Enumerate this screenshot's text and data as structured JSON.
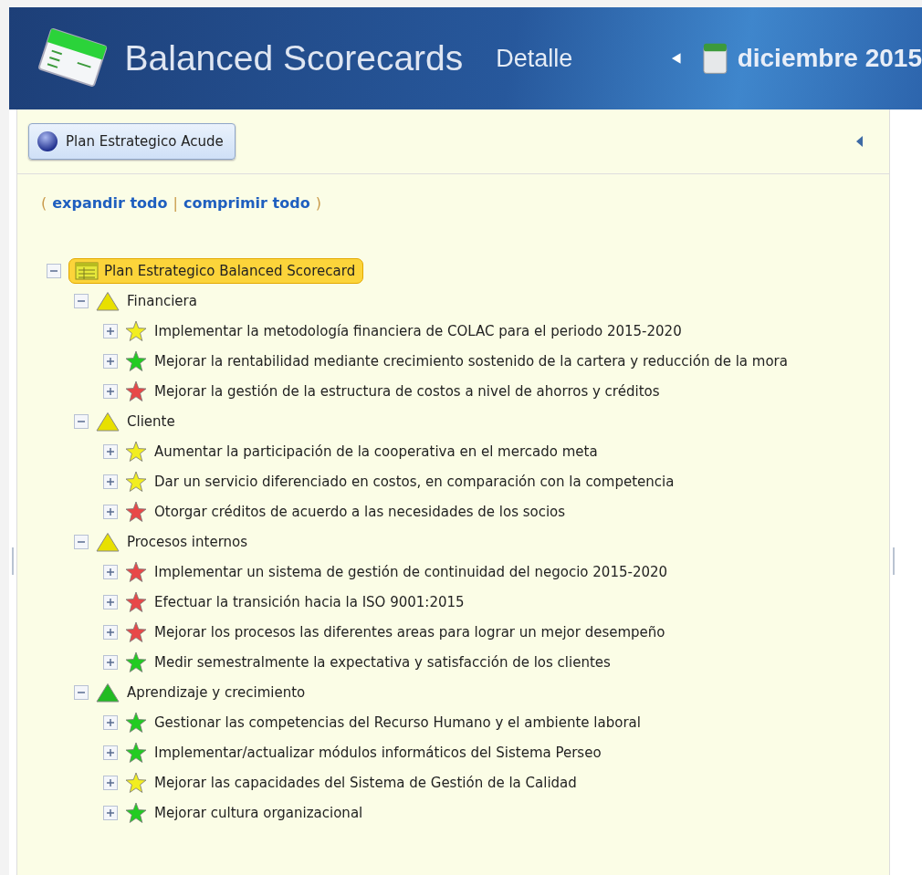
{
  "header": {
    "title": "Balanced Scorecards",
    "subtitle": "Detalle",
    "period": "diciembre 2015"
  },
  "plan_button": {
    "label": "Plan Estrategico Acude"
  },
  "links": {
    "open": "(",
    "expand": "expandir todo",
    "separator": "|",
    "collapse": "comprimir todo",
    "close": ")"
  },
  "tree": {
    "label": "Plan Estrategico Balanced Scorecard",
    "expanded": true,
    "selected": true,
    "children": [
      {
        "label": "Financiera",
        "expanded": true,
        "color": "#e8e000",
        "children": [
          {
            "label": "Implementar la metodología financiera de COLAC para el periodo 2015-2020",
            "expanded": false,
            "color": "#f2ee20"
          },
          {
            "label": "Mejorar la rentabilidad mediante crecimiento sostenido de la cartera y reducción de la mora",
            "expanded": false,
            "color": "#22cc22"
          },
          {
            "label": "Mejorar la gestión de la estructura de costos a nivel de ahorros y créditos",
            "expanded": false,
            "color": "#e84848"
          }
        ]
      },
      {
        "label": "Cliente",
        "expanded": true,
        "color": "#e8e000",
        "children": [
          {
            "label": "Aumentar la participación de la cooperativa en el mercado meta",
            "expanded": false,
            "color": "#f2ee20"
          },
          {
            "label": "Dar un servicio diferenciado en costos, en comparación con la competencia",
            "expanded": false,
            "color": "#f2ee20"
          },
          {
            "label": "Otorgar créditos de acuerdo a las necesidades de los socios",
            "expanded": false,
            "color": "#e84848"
          }
        ]
      },
      {
        "label": "Procesos internos",
        "expanded": true,
        "color": "#e8e000",
        "children": [
          {
            "label": "Implementar un sistema de gestión de continuidad del negocio 2015-2020",
            "expanded": false,
            "color": "#e84848"
          },
          {
            "label": "Efectuar la transición hacia la ISO 9001:2015",
            "expanded": false,
            "color": "#e84848"
          },
          {
            "label": "Mejorar los procesos las diferentes areas para lograr un mejor desempeño",
            "expanded": false,
            "color": "#e84848"
          },
          {
            "label": "Medir semestralmente la expectativa y satisfacción de los clientes",
            "expanded": false,
            "color": "#22cc22"
          }
        ]
      },
      {
        "label": "Aprendizaje y crecimiento",
        "expanded": true,
        "color": "#22bb22",
        "children": [
          {
            "label": "Gestionar las competencias del Recurso Humano y el ambiente laboral",
            "expanded": false,
            "color": "#22cc22"
          },
          {
            "label": "Implementar/actualizar módulos informáticos del Sistema Perseo",
            "expanded": false,
            "color": "#22cc22"
          },
          {
            "label": "Mejorar las capacidades del Sistema de Gestión de la Calidad",
            "expanded": false,
            "color": "#f2ee20"
          },
          {
            "label": "Mejorar cultura organizacional",
            "expanded": false,
            "color": "#22cc22"
          }
        ]
      }
    ]
  }
}
